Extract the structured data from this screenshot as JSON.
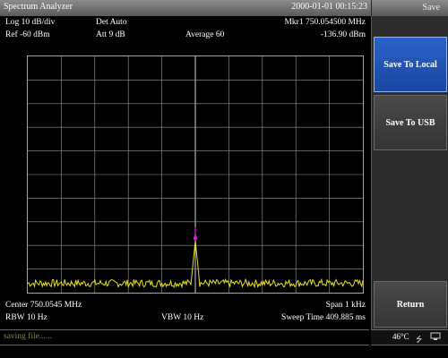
{
  "window": {
    "title": "Spectrum Analyzer",
    "datetime": "2000-01-01 00:15:23"
  },
  "menu": {
    "title": "Save",
    "softkeys": [
      {
        "label": "Save To Local",
        "active": true
      },
      {
        "label": "Save To USB",
        "active": false
      },
      {
        "label": "Return",
        "active": false
      }
    ]
  },
  "settings": {
    "scale": "Log 10 dB/div",
    "detector": "Det Auto",
    "marker_freq": "Mkr1  750.054500 MHz",
    "ref_level": "Ref -60 dBm",
    "attenuation": "Att 9 dB",
    "average": "Average 60",
    "marker_level": "-136.90 dBm",
    "center": "Center 750.0545 MHz",
    "span": "Span 1 kHz",
    "rbw": "RBW 10 Hz",
    "vbw": "VBW 10 Hz",
    "sweep_time": "Sweep Time 409.885 ms"
  },
  "status": {
    "message": "saving file......",
    "temperature": "46°C"
  },
  "colors": {
    "trace": "#e8e020",
    "marker": "#ff00ff",
    "grid": "#9a9a9a",
    "softkey_active": "#2a62c8"
  },
  "icons": {
    "usb": "usb-icon",
    "network": "network-icon"
  },
  "chart_data": {
    "type": "line",
    "xlabel": "",
    "ylabel": "",
    "x_range_mhz": [
      750.054,
      750.055
    ],
    "ylim_dbm": [
      -160,
      -60
    ],
    "grid": true,
    "noise_floor_dbm": -156,
    "peak": {
      "x_mhz": 750.0545,
      "y_dbm": -136.9
    }
  }
}
